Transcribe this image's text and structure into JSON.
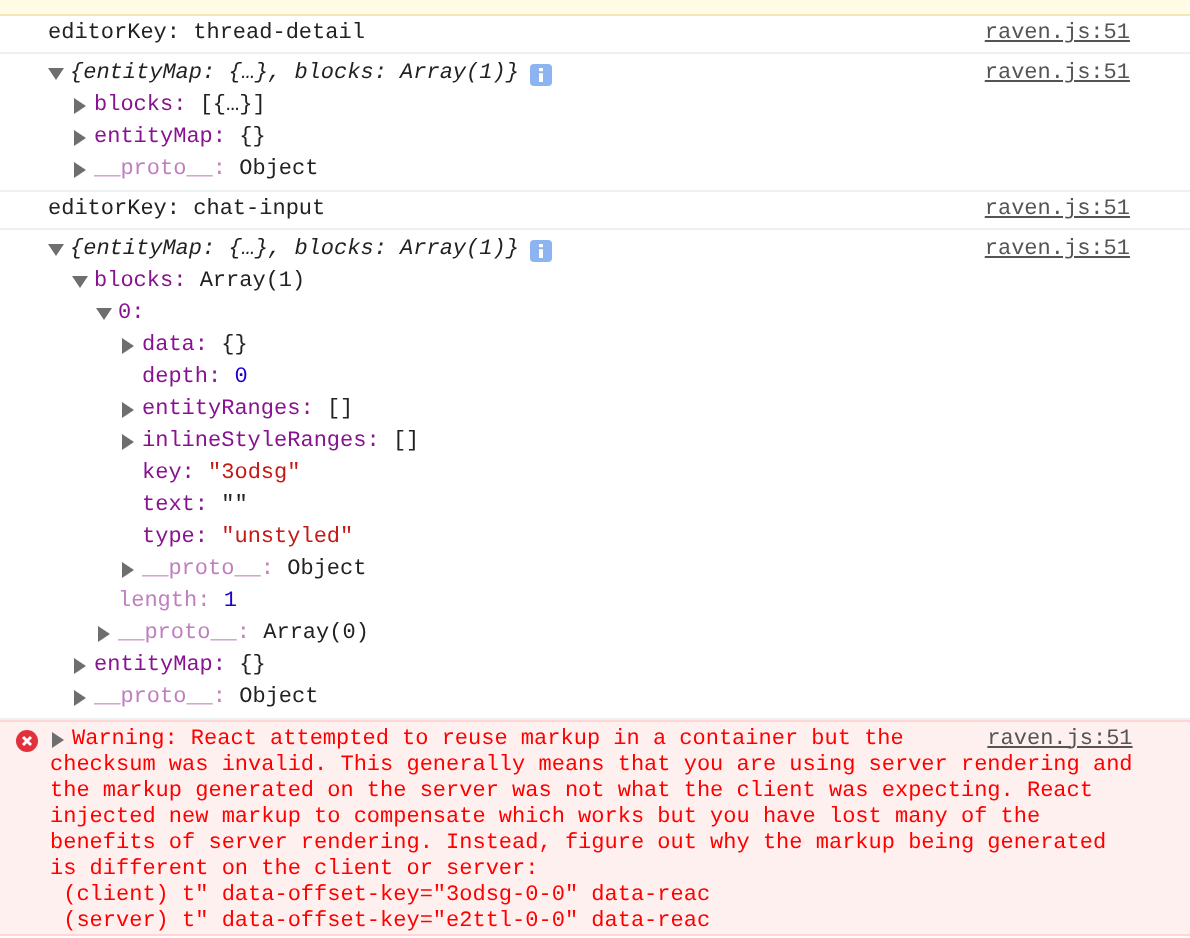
{
  "messages": [
    {
      "kind": "warning"
    },
    {
      "kind": "log",
      "text": "editorKey: thread-detail",
      "source": "raven.js:51"
    },
    {
      "kind": "object",
      "summary": "{entityMap: {…}, blocks: Array(1)}",
      "source": "raven.js:51",
      "expanded": true,
      "children": [
        {
          "key": "blocks:",
          "value": "[{…}]",
          "kind": "plain",
          "enumerable": true,
          "expanded": false
        },
        {
          "key": "entityMap:",
          "value": "{}",
          "kind": "plain",
          "enumerable": true,
          "expanded": false
        },
        {
          "key": "__proto__:",
          "value": "Object",
          "kind": "plain",
          "enumerable": false,
          "expanded": false
        }
      ]
    },
    {
      "kind": "log",
      "text": "editorKey: chat-input",
      "source": "raven.js:51"
    },
    {
      "kind": "object",
      "summary": "{entityMap: {…}, blocks: Array(1)}",
      "source": "raven.js:51",
      "expanded": true,
      "children": [
        {
          "key": "blocks:",
          "value": "Array(1)",
          "kind": "plain",
          "enumerable": true,
          "expanded": true,
          "children": [
            {
              "key": "0:",
              "enumerable": true,
              "expanded": true,
              "children": [
                {
                  "key": "data:",
                  "value": "{}",
                  "kind": "plain",
                  "enumerable": true,
                  "expanded": false
                },
                {
                  "key": "depth:",
                  "value": "0",
                  "kind": "number",
                  "enumerable": true
                },
                {
                  "key": "entityRanges:",
                  "value": "[]",
                  "kind": "plain",
                  "enumerable": true,
                  "expanded": false
                },
                {
                  "key": "inlineStyleRanges:",
                  "value": "[]",
                  "kind": "plain",
                  "enumerable": true,
                  "expanded": false
                },
                {
                  "key": "key:",
                  "value": "\"3odsg\"",
                  "kind": "string",
                  "enumerable": true
                },
                {
                  "key": "text:",
                  "value": "\"\"",
                  "kind": "plain",
                  "enumerable": true
                },
                {
                  "key": "type:",
                  "value": "\"unstyled\"",
                  "kind": "string",
                  "enumerable": true
                },
                {
                  "key": "__proto__:",
                  "value": "Object",
                  "kind": "plain",
                  "enumerable": false,
                  "expanded": false
                }
              ]
            },
            {
              "key": "length:",
              "value": "1",
              "kind": "number",
              "enumerable": false
            },
            {
              "key": "__proto__:",
              "value": "Array(0)",
              "kind": "plain",
              "enumerable": false,
              "expanded": false
            }
          ]
        },
        {
          "key": "entityMap:",
          "value": "{}",
          "kind": "plain",
          "enumerable": true,
          "expanded": false
        },
        {
          "key": "__proto__:",
          "value": "Object",
          "kind": "plain",
          "enumerable": false,
          "expanded": false
        }
      ]
    },
    {
      "kind": "error",
      "expanded": false,
      "source": "raven.js:51",
      "lines": [
        "Warning: React attempted to reuse markup in a container but the",
        "checksum was invalid. This generally means that you are using server rendering and",
        "the markup generated on the server was not what the client was expecting. React",
        "injected new markup to compensate which works but you have lost many of the",
        "benefits of server rendering. Instead, figure out why the markup being generated",
        "is different on the client or server:",
        " (client) t\" data-offset-key=\"3odsg-0-0\" data-reac",
        " (server) t\" data-offset-key=\"e2ttl-0-0\" data-reac"
      ]
    }
  ]
}
